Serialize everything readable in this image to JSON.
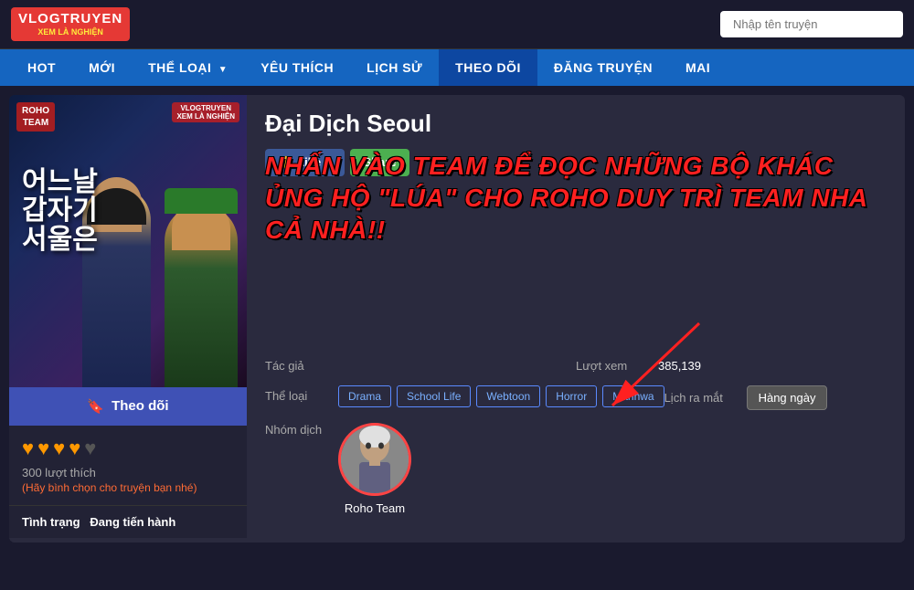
{
  "header": {
    "logo_main": "VLOGTRUYEN",
    "logo_sub": "XEM LÀ NGHIỆN",
    "search_placeholder": "Nhập tên truyện"
  },
  "nav": {
    "items": [
      {
        "label": "HOT",
        "has_arrow": false
      },
      {
        "label": "MỚI",
        "has_arrow": false
      },
      {
        "label": "THỂ LOẠI",
        "has_arrow": true
      },
      {
        "label": "YÊU THÍCH",
        "has_arrow": false
      },
      {
        "label": "LỊCH SỬ",
        "has_arrow": false
      },
      {
        "label": "THEO DÕI",
        "has_arrow": false
      },
      {
        "label": "ĐĂNG TRUYỆN",
        "has_arrow": false
      },
      {
        "label": "MAI",
        "has_arrow": false
      }
    ]
  },
  "manga": {
    "title": "Đại Dịch Seoul",
    "cover_text": "어느날 갑자기 서울은",
    "roho_badge_line1": "ROHO",
    "roho_badge_line2": "TEAM",
    "promo_text": "NHẤN VÀO TEAM ĐỂ ĐỌC NHỮNG BỘ KHÁC ỦNG HỘ \"LÚA\" CHO ROHO DUY TRÌ TEAM NHA CẢ NHÀ!!",
    "like_label": "Like",
    "like_count": "0",
    "share_label": "Share",
    "author_label": "Tác giả",
    "author_value": "",
    "genre_label": "Thể loại",
    "genres": [
      "Drama",
      "School Life",
      "Webtoon",
      "Horror",
      "Manhwa"
    ],
    "translator_label": "Nhóm dịch",
    "translator_name": "Roho Team",
    "views_label": "Lượt xem",
    "views_value": "385,139",
    "schedule_label": "Lịch ra mắt",
    "schedule_value": "Hàng ngày",
    "follow_label": "Theo dõi",
    "hearts": [
      "♥",
      "♥",
      "♥",
      "♥"
    ],
    "rating_count": "300 lượt thích",
    "rating_vote_text": "(Hãy bình chọn cho truyện bạn nhé)",
    "status_label": "Tình trạng",
    "status_value": "Đang tiến hành"
  }
}
